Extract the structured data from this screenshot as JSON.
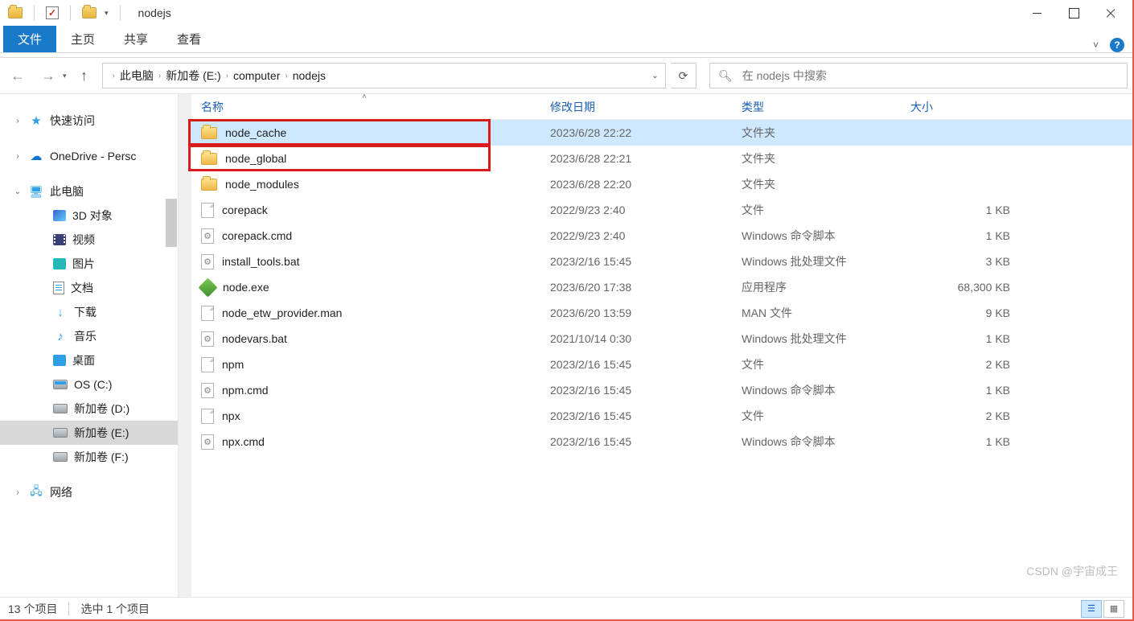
{
  "title": "nodejs",
  "ribbon": {
    "file": "文件",
    "tabs": [
      "主页",
      "共享",
      "查看"
    ]
  },
  "breadcrumbs": [
    "此电脑",
    "新加卷 (E:)",
    "computer",
    "nodejs"
  ],
  "search_placeholder": "在 nodejs 中搜索",
  "columns": {
    "name": "名称",
    "date": "修改日期",
    "type": "类型",
    "size": "大小"
  },
  "nav": [
    {
      "label": "快速访问",
      "icon": "star",
      "lvl": 1,
      "exp": ">"
    },
    {
      "sep": true
    },
    {
      "label": "OneDrive - Persc",
      "icon": "cloud",
      "lvl": 1,
      "exp": ">"
    },
    {
      "sep": true
    },
    {
      "label": "此电脑",
      "icon": "pc",
      "lvl": 1,
      "exp": "v"
    },
    {
      "label": "3D 对象",
      "icon": "3d",
      "lvl": 2
    },
    {
      "label": "视频",
      "icon": "video",
      "lvl": 2
    },
    {
      "label": "图片",
      "icon": "libcyan",
      "lvl": 2
    },
    {
      "label": "文档",
      "icon": "doc",
      "lvl": 2
    },
    {
      "label": "下载",
      "icon": "dl",
      "lvl": 2
    },
    {
      "label": "音乐",
      "icon": "music",
      "lvl": 2
    },
    {
      "label": "桌面",
      "icon": "libblue",
      "lvl": 2
    },
    {
      "label": "OS (C:)",
      "icon": "drive-os",
      "lvl": 2
    },
    {
      "label": "新加卷 (D:)",
      "icon": "drive",
      "lvl": 2
    },
    {
      "label": "新加卷 (E:)",
      "icon": "drive",
      "lvl": 2,
      "selected": true
    },
    {
      "label": "新加卷 (F:)",
      "icon": "drive",
      "lvl": 2
    },
    {
      "sep": true
    },
    {
      "label": "网络",
      "icon": "net",
      "lvl": 1,
      "exp": ">"
    }
  ],
  "files": [
    {
      "name": "node_cache",
      "date": "2023/6/28 22:22",
      "type": "文件夹",
      "size": "",
      "icon": "folder",
      "selected": true,
      "highlight": true
    },
    {
      "name": "node_global",
      "date": "2023/6/28 22:21",
      "type": "文件夹",
      "size": "",
      "icon": "folder",
      "highlight": true
    },
    {
      "name": "node_modules",
      "date": "2023/6/28 22:20",
      "type": "文件夹",
      "size": "",
      "icon": "folder"
    },
    {
      "name": "corepack",
      "date": "2022/9/23 2:40",
      "type": "文件",
      "size": "1 KB",
      "icon": "file"
    },
    {
      "name": "corepack.cmd",
      "date": "2022/9/23 2:40",
      "type": "Windows 命令脚本",
      "size": "1 KB",
      "icon": "gear"
    },
    {
      "name": "install_tools.bat",
      "date": "2023/2/16 15:45",
      "type": "Windows 批处理文件",
      "size": "3 KB",
      "icon": "gear"
    },
    {
      "name": "node.exe",
      "date": "2023/6/20 17:38",
      "type": "应用程序",
      "size": "68,300 KB",
      "icon": "exe"
    },
    {
      "name": "node_etw_provider.man",
      "date": "2023/6/20 13:59",
      "type": "MAN 文件",
      "size": "9 KB",
      "icon": "file"
    },
    {
      "name": "nodevars.bat",
      "date": "2021/10/14 0:30",
      "type": "Windows 批处理文件",
      "size": "1 KB",
      "icon": "gear"
    },
    {
      "name": "npm",
      "date": "2023/2/16 15:45",
      "type": "文件",
      "size": "2 KB",
      "icon": "file"
    },
    {
      "name": "npm.cmd",
      "date": "2023/2/16 15:45",
      "type": "Windows 命令脚本",
      "size": "1 KB",
      "icon": "gear"
    },
    {
      "name": "npx",
      "date": "2023/2/16 15:45",
      "type": "文件",
      "size": "2 KB",
      "icon": "file"
    },
    {
      "name": "npx.cmd",
      "date": "2023/2/16 15:45",
      "type": "Windows 命令脚本",
      "size": "1 KB",
      "icon": "gear"
    }
  ],
  "status": {
    "count": "13 个项目",
    "selection": "选中 1 个项目"
  },
  "watermark": "CSDN @宇宙成王"
}
